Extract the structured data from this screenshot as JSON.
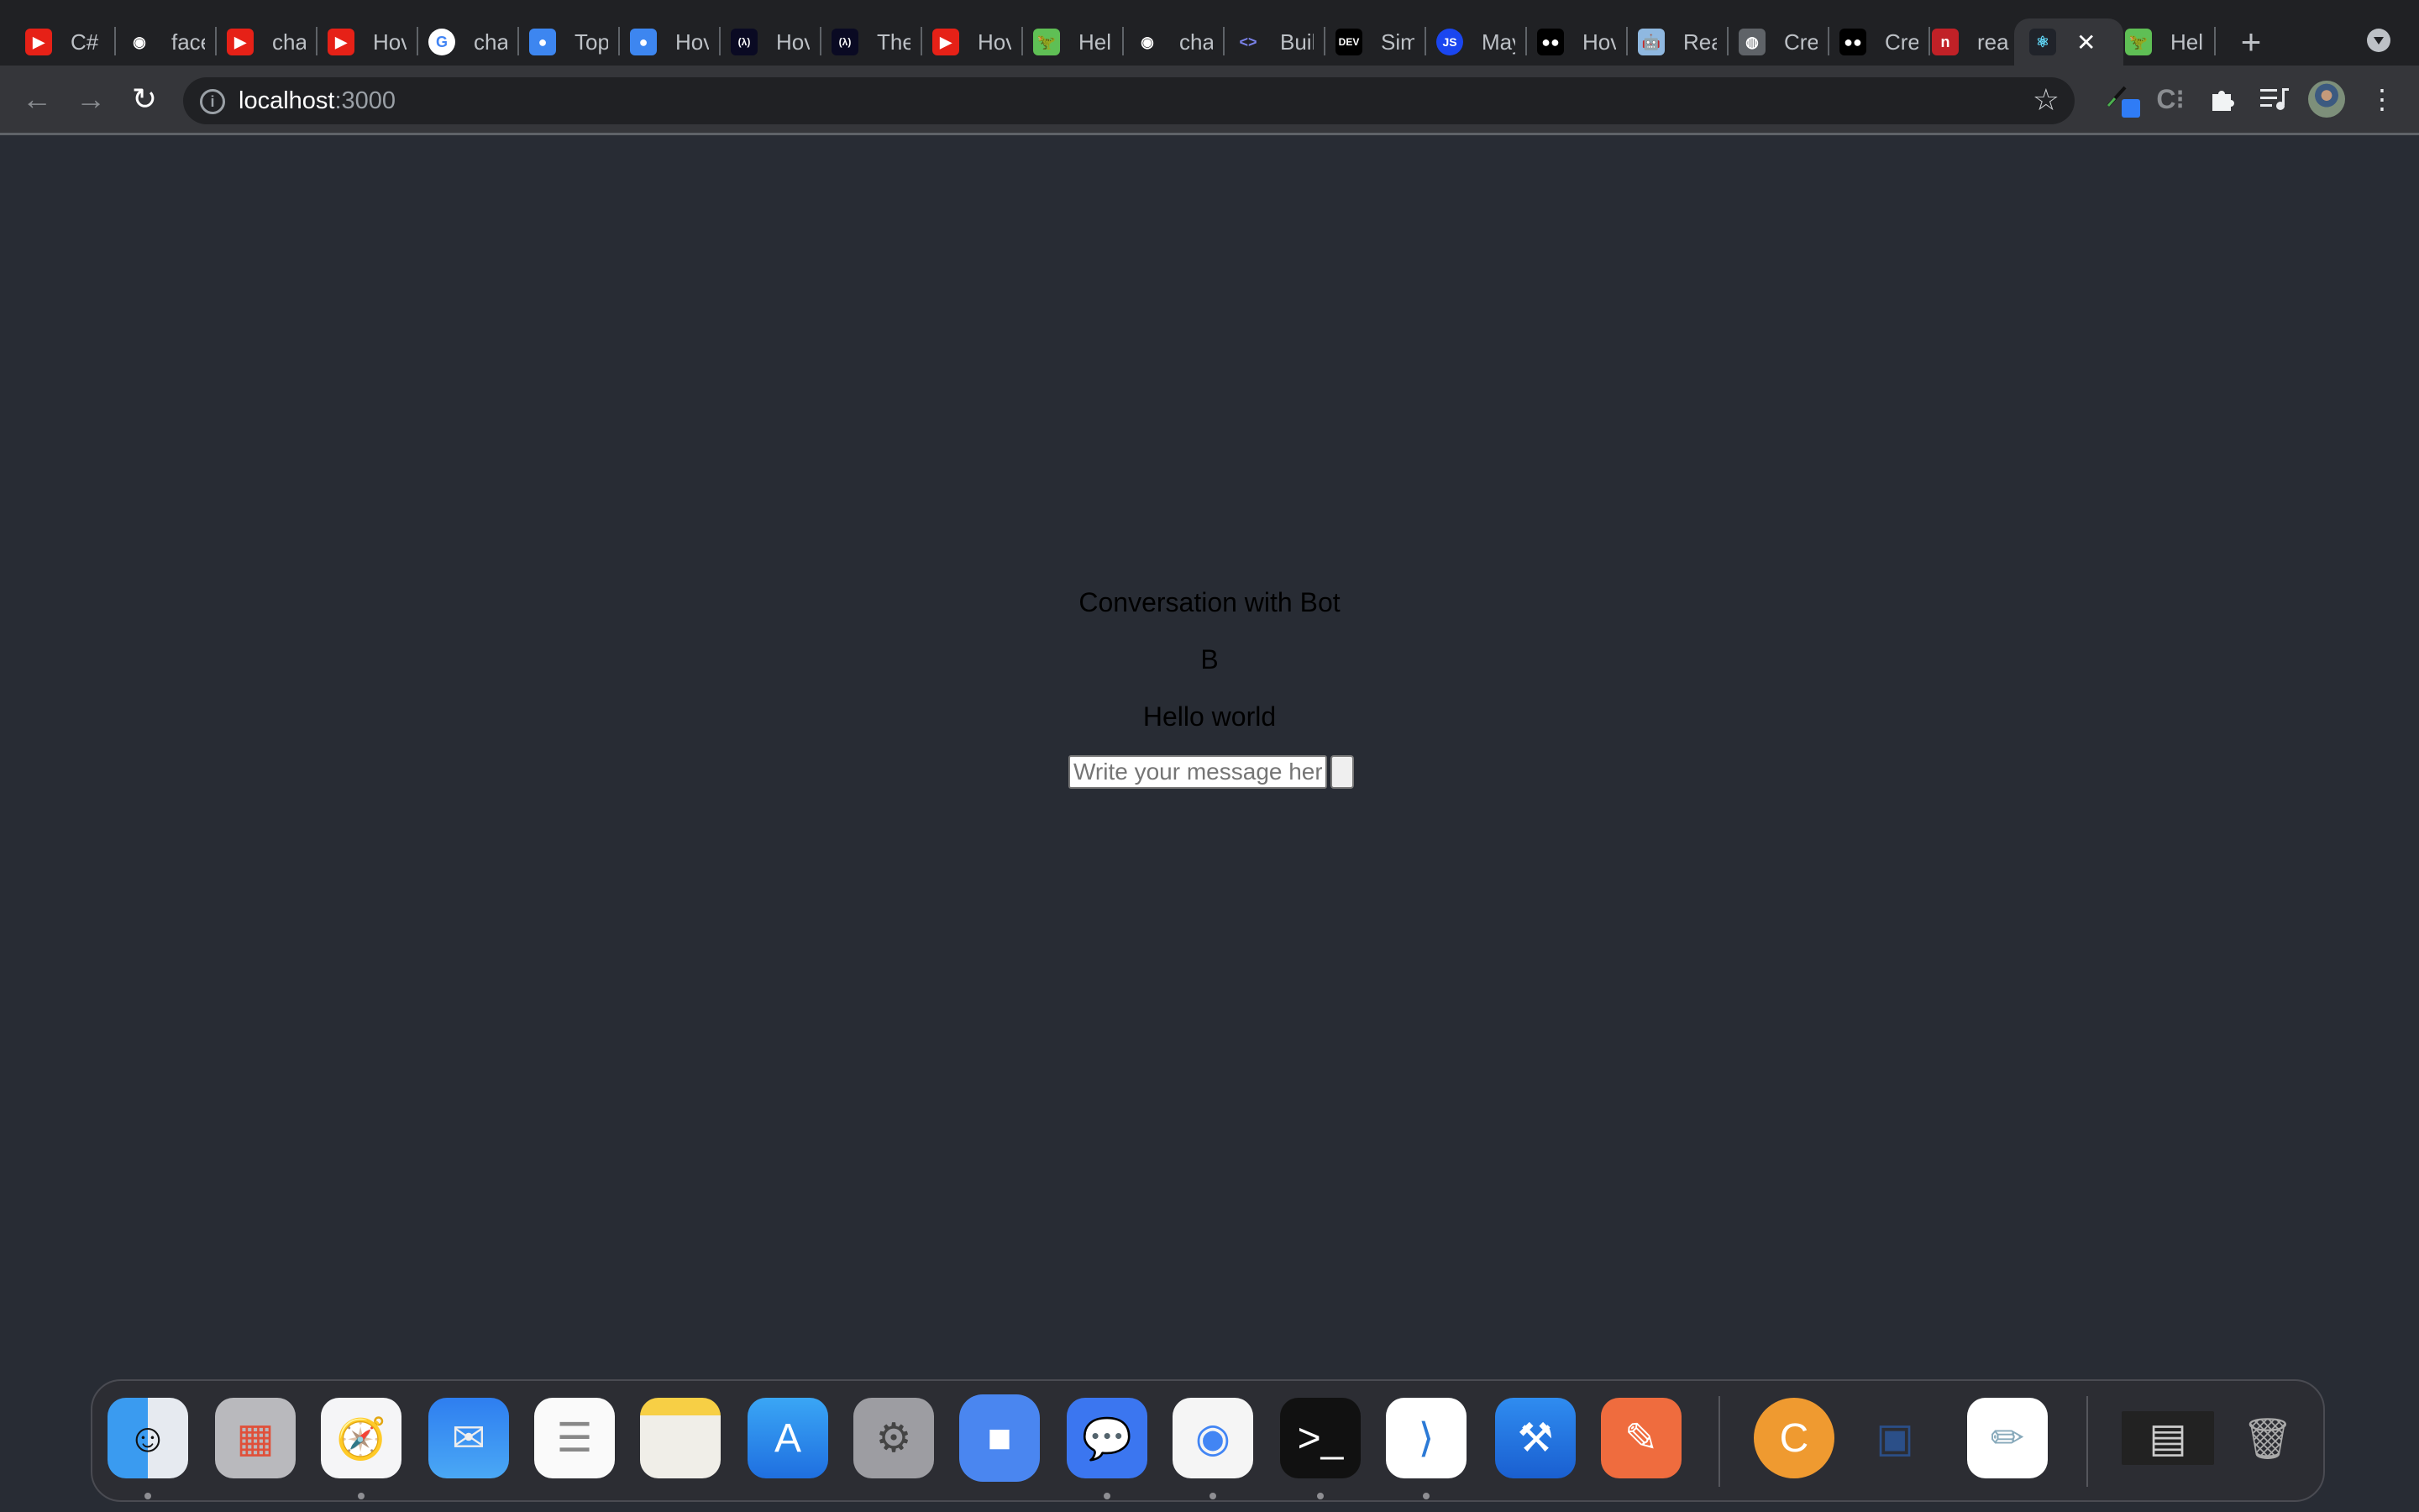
{
  "browser": {
    "tabs": [
      {
        "title": "C#",
        "icon": "youtube-icon",
        "color": "#e62117"
      },
      {
        "title": "face",
        "icon": "github-icon",
        "color": "#202124"
      },
      {
        "title": "cha",
        "icon": "youtube-icon",
        "color": "#e62117"
      },
      {
        "title": "Hov",
        "icon": "youtube-icon",
        "color": "#e62117"
      },
      {
        "title": "cha",
        "icon": "google-icon",
        "color": "#ffffff"
      },
      {
        "title": "Top",
        "icon": "chat-bubbles-icon",
        "color": "#3d86f0"
      },
      {
        "title": "Hov",
        "icon": "chat-bubbles-icon",
        "color": "#3d86f0"
      },
      {
        "title": "Hov",
        "icon": "freecodecamp-icon",
        "color": "#0a0a23"
      },
      {
        "title": "The",
        "icon": "freecodecamp-icon",
        "color": "#0a0a23"
      },
      {
        "title": "Hov",
        "icon": "youtube-icon",
        "color": "#e62117"
      },
      {
        "title": "Hell",
        "icon": "dinosaur-icon",
        "color": "#5fbf55"
      },
      {
        "title": "cha",
        "icon": "github-icon",
        "color": "#202124"
      },
      {
        "title": "Buil",
        "icon": "code-brackets-icon",
        "color": "#202124"
      },
      {
        "title": "Sim",
        "icon": "dev-icon",
        "color": "#000000"
      },
      {
        "title": "May",
        "icon": "js-icon",
        "color": "#1a46f0"
      },
      {
        "title": "Hov",
        "icon": "medium-icon",
        "color": "#000000"
      },
      {
        "title": "Rea",
        "icon": "robot-icon",
        "color": "#8fb8e0"
      },
      {
        "title": "Cre",
        "icon": "globe-icon",
        "color": "#5f6368"
      },
      {
        "title": "Cre",
        "icon": "medium-icon",
        "color": "#000000"
      },
      {
        "title": "rea",
        "icon": "npm-icon",
        "color": "#c12127"
      },
      {
        "title": "",
        "icon": "react-icon",
        "color": "#20232a",
        "active": true
      },
      {
        "title": "Hell",
        "icon": "dinosaur-icon",
        "color": "#5fbf55"
      }
    ],
    "new_tab": "+",
    "close_tab": "✕",
    "url_host": "localhost",
    "url_port": ":3000",
    "extensions": [
      "eyedropper-icon",
      "c-extension-icon",
      "puzzle-extensions-icon",
      "media-queue-icon",
      "profile-avatar",
      "more-menu-icon"
    ]
  },
  "page": {
    "title": "Conversation with Bot",
    "sender": "B",
    "message": "Hello world",
    "input_placeholder": "Write your message here",
    "input_value": "",
    "send_label": ""
  },
  "dock": {
    "apps": [
      {
        "name": "Finder",
        "running": true
      },
      {
        "name": "Launchpad",
        "running": false
      },
      {
        "name": "Safari",
        "running": true
      },
      {
        "name": "Mail",
        "running": false
      },
      {
        "name": "Reminders",
        "running": false
      },
      {
        "name": "Notes",
        "running": false
      },
      {
        "name": "App Store",
        "running": false
      },
      {
        "name": "System Preferences",
        "running": false
      },
      {
        "name": "Zoom",
        "running": false
      },
      {
        "name": "Signal",
        "running": true
      },
      {
        "name": "Google Chrome",
        "running": true
      },
      {
        "name": "Terminal",
        "running": true
      },
      {
        "name": "Visual Studio Code",
        "running": true
      },
      {
        "name": "Xcode",
        "running": false
      },
      {
        "name": "Postman",
        "running": false
      },
      {
        "name": "Coursera",
        "running": false
      },
      {
        "name": "VirtualBox",
        "running": false
      },
      {
        "name": "TextEdit",
        "running": false
      },
      {
        "name": "Screenshot",
        "running": false
      },
      {
        "name": "Trash",
        "running": false
      }
    ]
  }
}
